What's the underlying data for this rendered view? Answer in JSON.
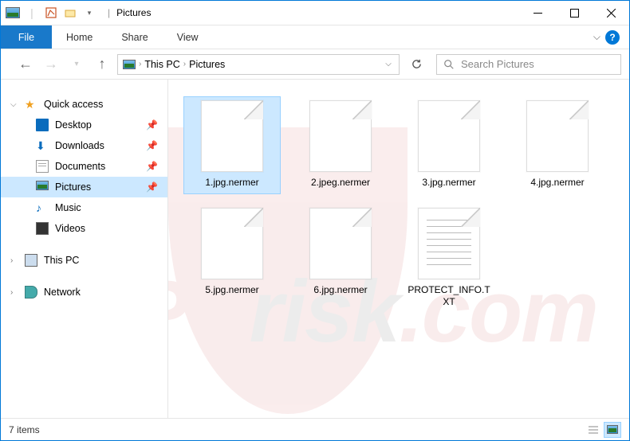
{
  "title": "Pictures",
  "menubar": {
    "file": "File",
    "items": [
      "Home",
      "Share",
      "View"
    ]
  },
  "breadcrumbs": [
    "This PC",
    "Pictures"
  ],
  "search": {
    "placeholder": "Search Pictures"
  },
  "sidebar": {
    "quick_access": {
      "label": "Quick access",
      "expanded": true
    },
    "items": [
      {
        "label": "Desktop",
        "pinned": true
      },
      {
        "label": "Downloads",
        "pinned": true
      },
      {
        "label": "Documents",
        "pinned": true
      },
      {
        "label": "Pictures",
        "pinned": true,
        "selected": true
      },
      {
        "label": "Music",
        "pinned": false
      },
      {
        "label": "Videos",
        "pinned": false
      }
    ],
    "this_pc": "This PC",
    "network": "Network"
  },
  "files": [
    {
      "name": "1.jpg.nermer",
      "selected": true,
      "type": "file"
    },
    {
      "name": "2.jpeg.nermer",
      "selected": false,
      "type": "file"
    },
    {
      "name": "3.jpg.nermer",
      "selected": false,
      "type": "file"
    },
    {
      "name": "4.jpg.nermer",
      "selected": false,
      "type": "file"
    },
    {
      "name": "5.jpg.nermer",
      "selected": false,
      "type": "file"
    },
    {
      "name": "6.jpg.nermer",
      "selected": false,
      "type": "file"
    },
    {
      "name": "PROTECT_INFO.TXT",
      "selected": false,
      "type": "txt"
    }
  ],
  "status": {
    "count_label": "7 items"
  },
  "watermark": {
    "brand1": "PC",
    "brand2": "risk",
    "brand3": ".com"
  }
}
